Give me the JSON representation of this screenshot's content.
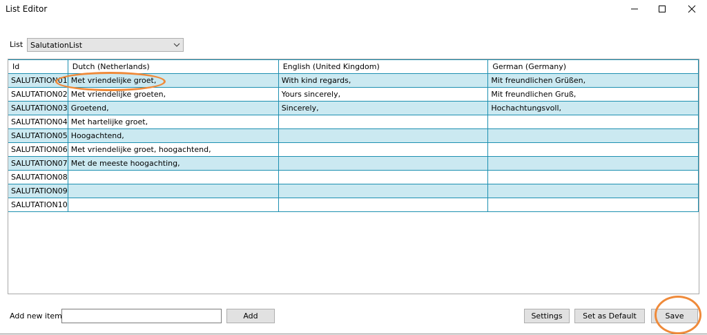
{
  "window": {
    "title": "List Editor"
  },
  "list_selector": {
    "label": "List",
    "value": "SalutationList"
  },
  "grid": {
    "columns": [
      "Id",
      "Dutch (Netherlands)",
      "English (United Kingdom)",
      "German (Germany)"
    ],
    "rows": [
      [
        "SALUTATION01",
        "Met vriendelijke groet,",
        "With kind regards,",
        "Mit freundlichen Grüßen,"
      ],
      [
        "SALUTATION02",
        "Met vriendelijke groeten,",
        "Yours sincerely,",
        "Mit freundlichen Gruß,"
      ],
      [
        "SALUTATION03",
        "Groetend,",
        "Sincerely,",
        "Hochachtungsvoll,"
      ],
      [
        "SALUTATION04",
        "Met hartelijke groet,",
        "",
        ""
      ],
      [
        "SALUTATION05",
        "Hoogachtend,",
        "",
        ""
      ],
      [
        "SALUTATION06",
        "Met vriendelijke groet, hoogachtend,",
        "",
        ""
      ],
      [
        "SALUTATION07",
        "Met de meeste hoogachting,",
        "",
        ""
      ],
      [
        "SALUTATION08",
        "",
        "",
        ""
      ],
      [
        "SALUTATION09",
        "",
        "",
        ""
      ],
      [
        "SALUTATION10",
        "",
        "",
        ""
      ]
    ]
  },
  "add_item": {
    "label": "Add new item",
    "value": "",
    "button": "Add"
  },
  "buttons": {
    "settings": "Settings",
    "set_default": "Set as Default",
    "save": "Save"
  },
  "colors": {
    "row_alt": "#cbe9f1",
    "grid_line": "#1c8fb0",
    "annotation": "#ef8a3a"
  }
}
